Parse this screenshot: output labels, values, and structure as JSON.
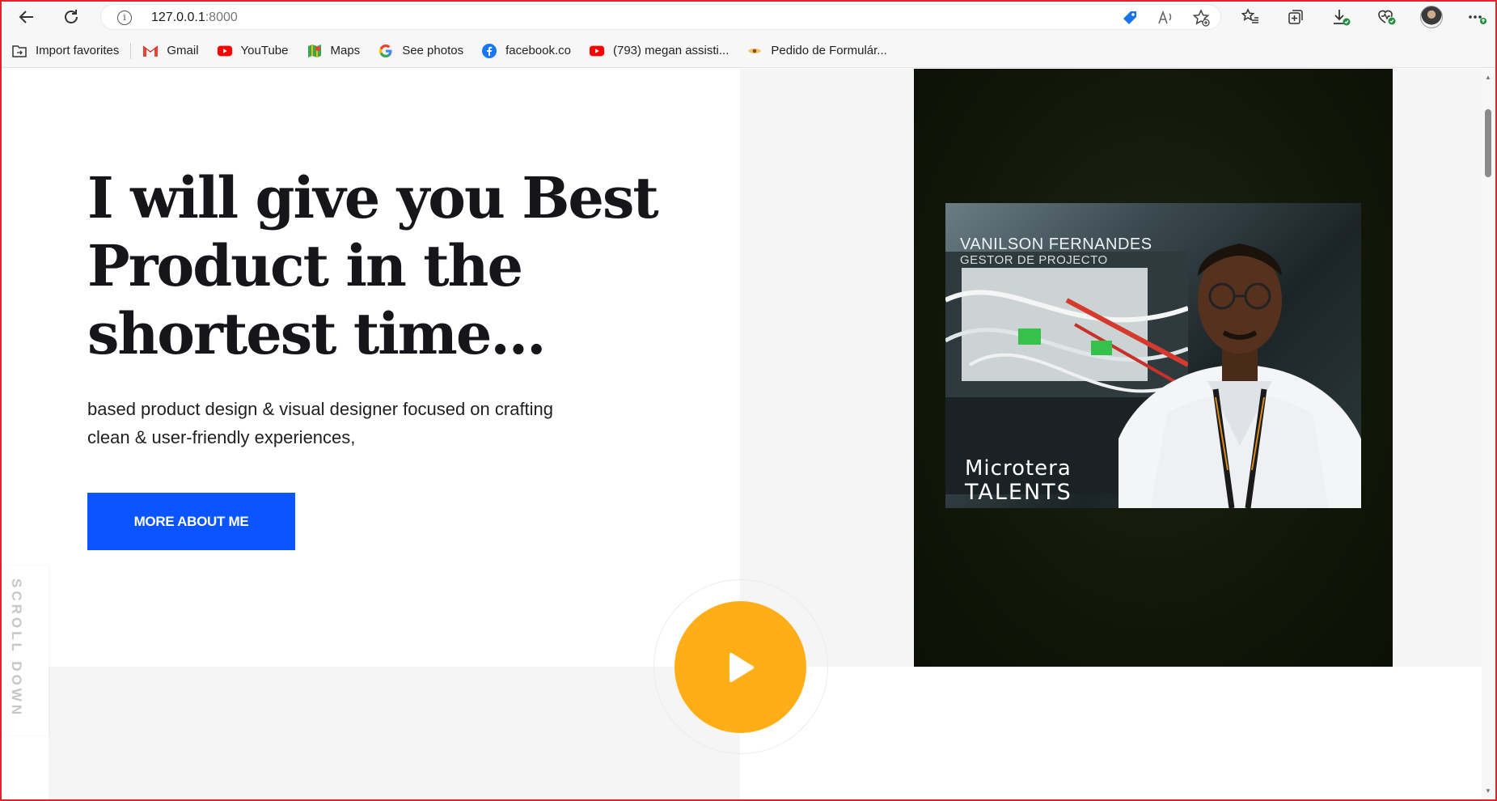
{
  "browser": {
    "url_host": "127.0.0.1",
    "url_port": ":8000"
  },
  "bookmarks": [
    {
      "label": "Import favorites",
      "icon": "folder-import-icon"
    },
    {
      "label": "Gmail",
      "icon": "gmail-icon",
      "color": "#ea4335"
    },
    {
      "label": "YouTube",
      "icon": "youtube-icon",
      "color": "#ff0000"
    },
    {
      "label": "Maps",
      "icon": "maps-icon",
      "color": "#34a853"
    },
    {
      "label": "See photos",
      "icon": "google-icon",
      "color": "#4285f4"
    },
    {
      "label": "facebook.co",
      "icon": "facebook-icon",
      "color": "#1877f2"
    },
    {
      "label": "(793) megan assisti...",
      "icon": "youtube-icon",
      "color": "#ff0000"
    },
    {
      "label": "Pedido de Formulár...",
      "icon": "bookmark-eye-icon",
      "color": "#e0a030"
    }
  ],
  "hero": {
    "title": "I will give you Best Product in the shortest time...",
    "subtitle": "based product design & visual designer focused on crafting clean & user-friendly experiences,",
    "cta_label": "MORE ABOUT ME",
    "scroll_label": "SCROLL DOWN"
  },
  "photo": {
    "name": "VANILSON FERNANDES",
    "role": "GESTOR DE PROJECTO",
    "brand": "Microtera",
    "brand_line2": "TALENTS"
  },
  "colors": {
    "accent_blue": "#0a55ff",
    "play_orange": "#ffae17",
    "window_border": "#e0242a"
  }
}
